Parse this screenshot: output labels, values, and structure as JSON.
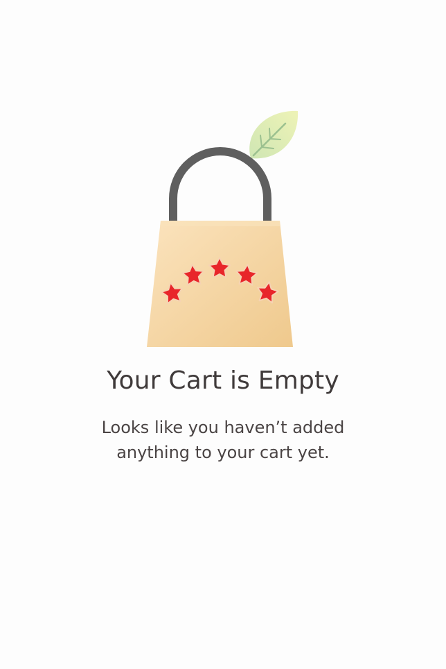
{
  "empty_state": {
    "title": "Your Cart is Empty",
    "message_line1": "Looks like you haven’t added",
    "message_line2": "anything to your cart yet."
  },
  "illustration": {
    "icon": "shopping-bag-icon",
    "decorations": [
      "leaf-icon",
      "star-icon"
    ],
    "star_count": 5,
    "colors": {
      "bag": "#f3d29b",
      "handle": "#5f5f5f",
      "stars": "#e8262a",
      "leaf": "#d8ecb0"
    }
  }
}
